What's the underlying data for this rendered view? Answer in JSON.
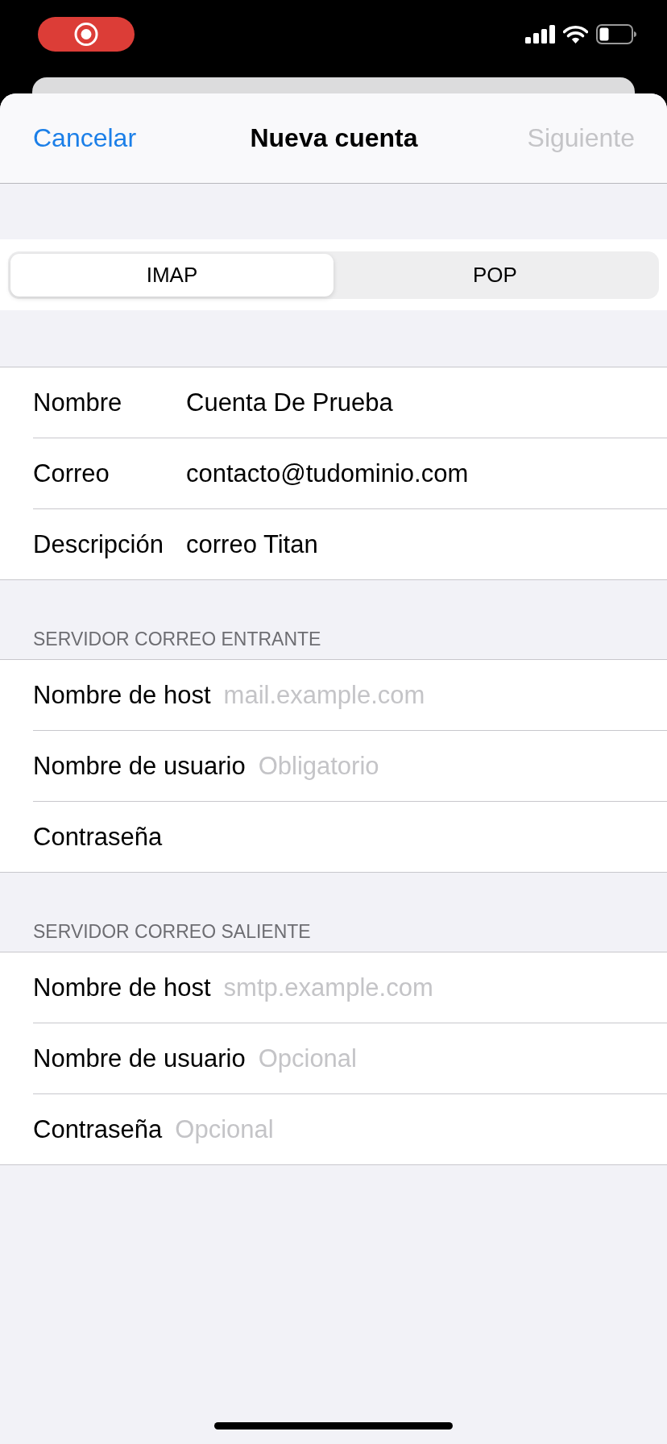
{
  "nav": {
    "cancel": "Cancelar",
    "title": "Nueva cuenta",
    "next": {
      "label": "Siguiente",
      "disabled": true
    }
  },
  "segments": [
    {
      "label": "IMAP",
      "selected": true
    },
    {
      "label": "POP",
      "selected": false
    }
  ],
  "account_fields": [
    {
      "label": "Nombre",
      "value": "Cuenta De Prueba"
    },
    {
      "label": "Correo",
      "value": "contacto@tudominio.com"
    },
    {
      "label": "Descripción",
      "value": "correo Titan"
    }
  ],
  "sections": [
    {
      "header": "SERVIDOR CORREO ENTRANTE",
      "fields": [
        {
          "label": "Nombre de host",
          "placeholder": "mail.example.com"
        },
        {
          "label": "Nombre de usuario",
          "placeholder": "Obligatorio"
        },
        {
          "label": "Contraseña"
        }
      ]
    },
    {
      "header": "SERVIDOR CORREO SALIENTE",
      "fields": [
        {
          "label": "Nombre de host",
          "placeholder": "smtp.example.com"
        },
        {
          "label": "Nombre de usuario",
          "placeholder": "Opcional"
        },
        {
          "label": "Contraseña",
          "placeholder": "Opcional"
        }
      ]
    }
  ]
}
